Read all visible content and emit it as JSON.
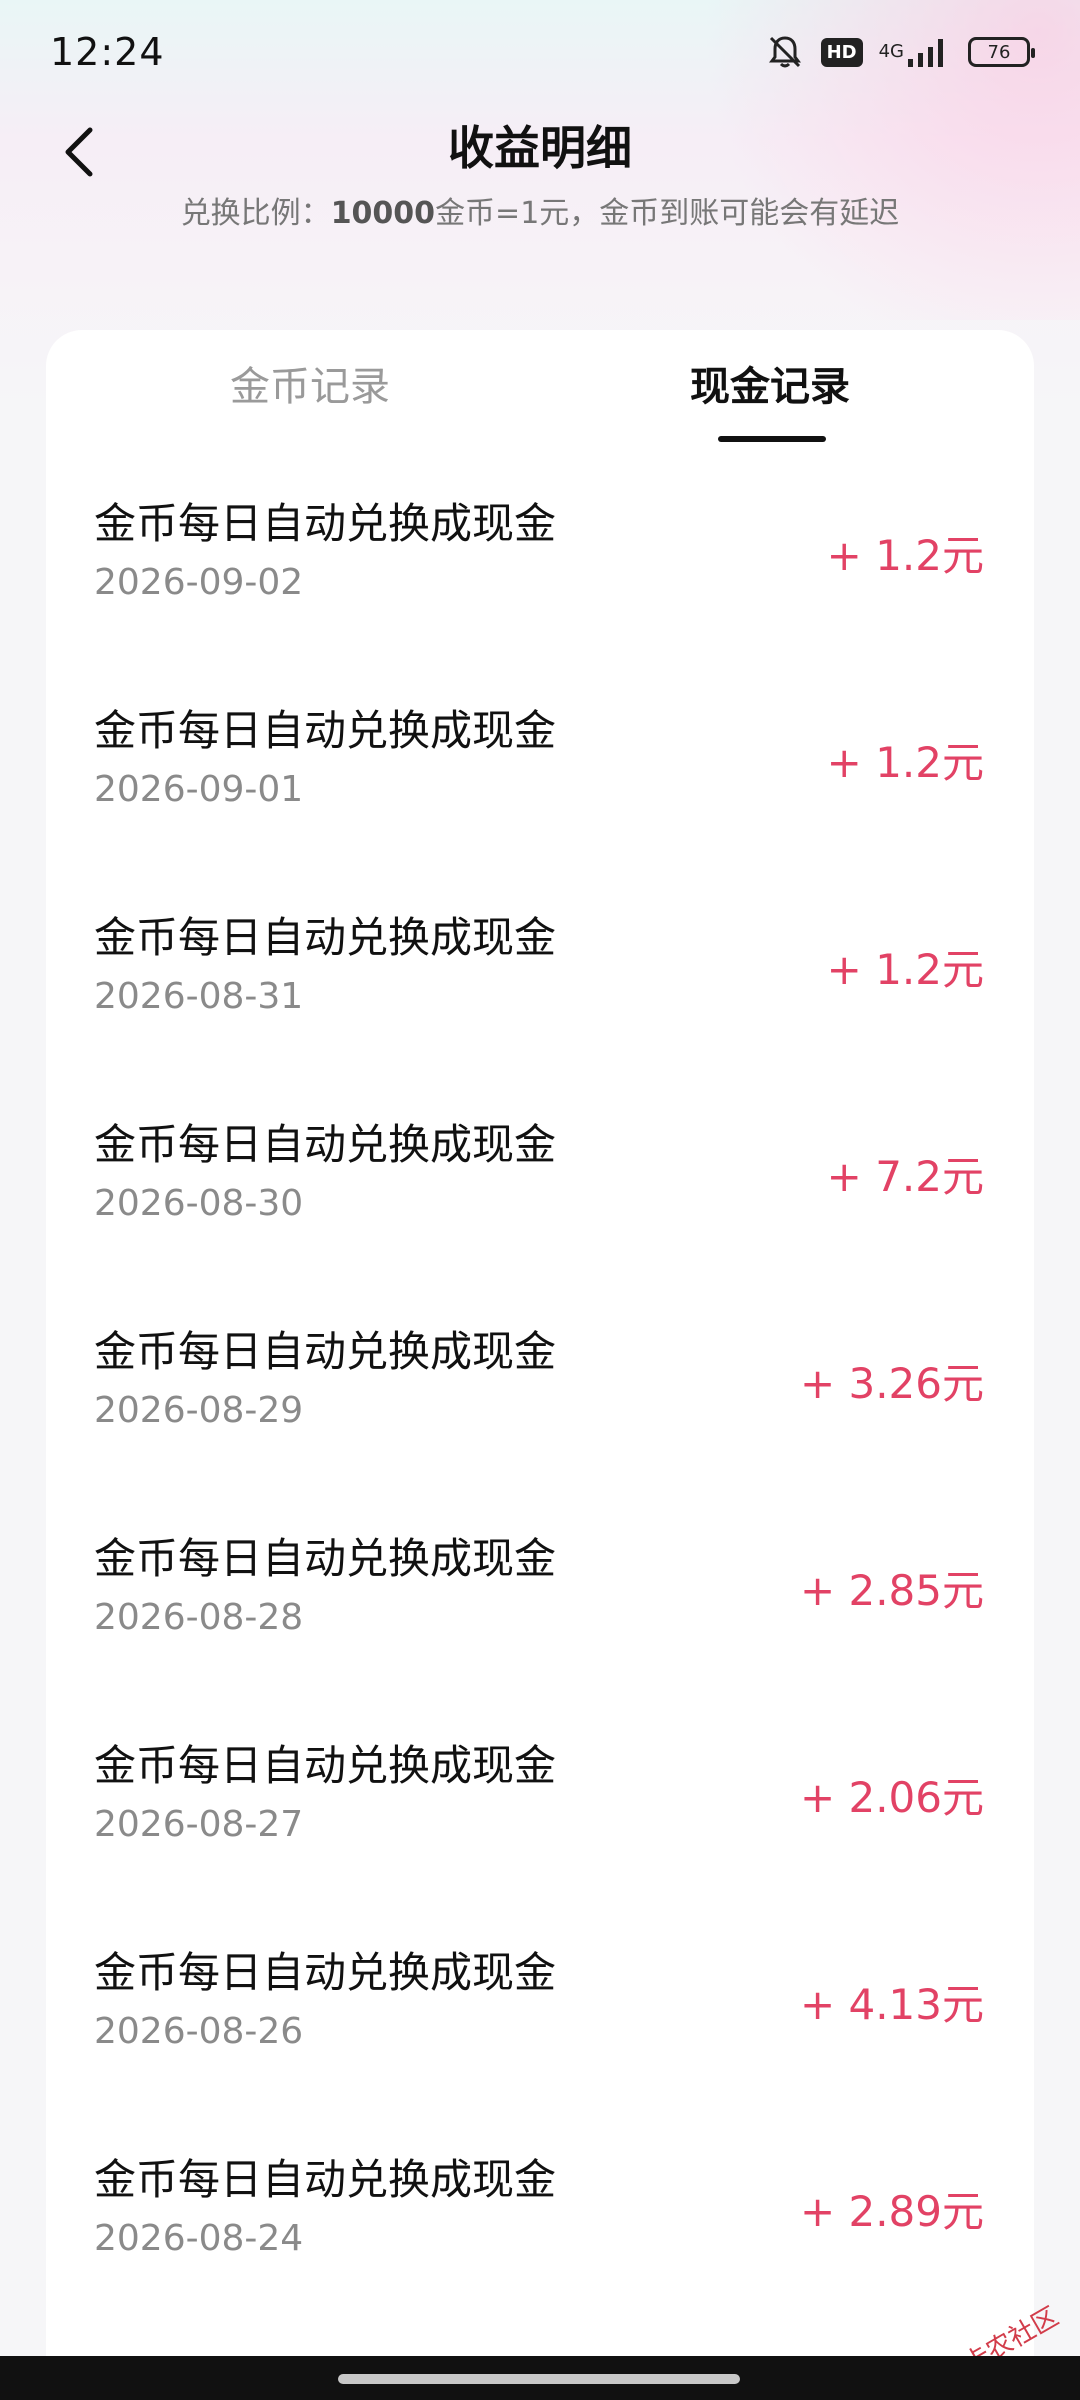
{
  "status_bar": {
    "time": "12:24",
    "hd_badge": "HD",
    "network": "4G",
    "battery": "76"
  },
  "header": {
    "title": "收益明细"
  },
  "subtitle": {
    "prefix": "兑换比例：",
    "rate": "10000",
    "suffix": "金币=1元，金币到账可能会有延迟"
  },
  "tabs": [
    {
      "label": "金币记录",
      "active": false
    },
    {
      "label": "现金记录",
      "active": true
    }
  ],
  "records": [
    {
      "title": "金币每日自动兑换成现金",
      "date": "2026-09-02",
      "amount": "+ 1.2元"
    },
    {
      "title": "金币每日自动兑换成现金",
      "date": "2026-09-01",
      "amount": "+ 1.2元"
    },
    {
      "title": "金币每日自动兑换成现金",
      "date": "2026-08-31",
      "amount": "+ 1.2元"
    },
    {
      "title": "金币每日自动兑换成现金",
      "date": "2026-08-30",
      "amount": "+ 7.2元"
    },
    {
      "title": "金币每日自动兑换成现金",
      "date": "2026-08-29",
      "amount": "+ 3.26元"
    },
    {
      "title": "金币每日自动兑换成现金",
      "date": "2026-08-28",
      "amount": "+ 2.85元"
    },
    {
      "title": "金币每日自动兑换成现金",
      "date": "2026-08-27",
      "amount": "+ 2.06元"
    },
    {
      "title": "金币每日自动兑换成现金",
      "date": "2026-08-26",
      "amount": "+ 4.13元"
    },
    {
      "title": "金币每日自动兑换成现金",
      "date": "2026-08-24",
      "amount": "+ 2.89元"
    }
  ],
  "watermark": "卡农社区",
  "colors": {
    "amount": "#e24265",
    "active_tab": "#111111",
    "inactive_tab": "#9a9a9a"
  }
}
